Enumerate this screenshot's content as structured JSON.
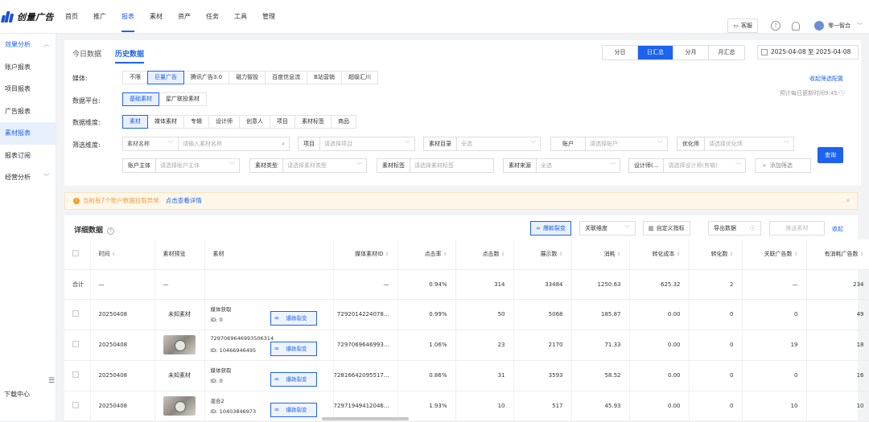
{
  "app": {
    "logo_text": "创量广告"
  },
  "topnav": {
    "items": [
      "首页",
      "推广",
      "报表",
      "素材",
      "资产",
      "任务",
      "工具",
      "管理"
    ],
    "active_index": 2
  },
  "topright": {
    "service_label": "客服",
    "help_icon": "?",
    "user_name": "零一智合"
  },
  "sidebar": {
    "groups": [
      {
        "label": "效果分析",
        "expanded": true,
        "items": [
          "账户报表",
          "项目报表",
          "广告报表",
          "素材报表",
          "报表订阅"
        ],
        "active": "素材报表"
      },
      {
        "label": "经营分析",
        "expanded": false
      }
    ],
    "bottom": "下载中心"
  },
  "tabs": [
    "今日数据",
    "历史数据"
  ],
  "active_tab": "历史数据",
  "granularity": [
    "分日",
    "日汇总",
    "分月",
    "月汇总"
  ],
  "granularity_active": "日汇总",
  "date_range": "2025-04-08 至 2025-04-08",
  "filters": {
    "media_label": "媒体:",
    "media_options": [
      "不限",
      "巨量广告",
      "腾讯广告3.0",
      "磁力智投",
      "百度信息流",
      "B站营销",
      "超级汇川"
    ],
    "media_active": "巨量广告",
    "platform_label": "数据平台:",
    "platform_options": [
      "基础素材",
      "星广联投素材"
    ],
    "platform_active": "基础素材",
    "dimension_label": "数据维度:",
    "dimension_options": [
      "素材",
      "媒体素材",
      "专辑",
      "设计师",
      "创意人",
      "项目",
      "素材标签",
      "商品"
    ],
    "dimension_active": "素材",
    "filter_label": "筛选维度:",
    "collapse_filters": "收起筛选配置",
    "update_hint": "预计每日更新时间9:45",
    "fields": {
      "name_select": "素材名称",
      "name_placeholder": "请输入素材名称",
      "project_label": "项目",
      "project_placeholder": "请选择项目",
      "dir_label": "素材目录",
      "dir_placeholder": "全选",
      "account_label": "账户",
      "account_placeholder": "请选择账户",
      "optimizer_label": "优化师",
      "optimizer_placeholder": "请选择优化师",
      "owner_label": "账户主体",
      "owner_placeholder": "请选择账户主体",
      "type_label": "素材类型",
      "type_placeholder": "请选择素材类型",
      "tag_label": "素材标签",
      "tag_placeholder": "请选择素材标签",
      "source_label": "素材来源",
      "source_placeholder": "全选",
      "designer_label": "设计师(...",
      "designer_placeholder": "请选择设计师(剪辑)",
      "add_filter": "添加筛选"
    },
    "query_button": "查询"
  },
  "alert": {
    "text": "当前有7个账户数据拉取异常",
    "link": "点击查看详情"
  },
  "table": {
    "title": "详细数据",
    "toolbar": {
      "viral": "爆款裂变",
      "related": "关联维度",
      "custom": "自定义指标",
      "export": "导出数据",
      "push": "推送素材",
      "collapse": "收起"
    },
    "headers": [
      "时间",
      "素材预览",
      "素材",
      "媒体素材ID",
      "点击率",
      "点击数",
      "展示数",
      "消耗",
      "转化成本",
      "转化数",
      "关联广告数",
      "有消耗广告数"
    ],
    "total": {
      "label": "合计",
      "time": "—",
      "preview": "—",
      "media_id": "—",
      "ctr": "0.94%",
      "clicks": "314",
      "impressions": "33484",
      "cost": "1250.63",
      "cpa": "625.32",
      "conv": "2",
      "related": "—",
      "spent_ads": "234"
    },
    "rows": [
      {
        "time": "20250408",
        "preview": "未知素材",
        "name": "媒体获取",
        "id": "ID: 0",
        "media_id": "7292014224078...",
        "ctr": "0.99%",
        "clicks": "50",
        "impressions": "5068",
        "cost": "185.87",
        "cpa": "0.00",
        "conv": "0",
        "related": "0",
        "spent_ads": "49",
        "has_thumb": false
      },
      {
        "time": "20250408",
        "preview": "",
        "name": "7297069646993506314",
        "id": "ID: 10466946495",
        "media_id": "7297069646993...",
        "ctr": "1.06%",
        "clicks": "23",
        "impressions": "2170",
        "cost": "71.33",
        "cpa": "0.00",
        "conv": "0",
        "related": "19",
        "spent_ads": "18",
        "has_thumb": true
      },
      {
        "time": "20250408",
        "preview": "未知素材",
        "name": "媒体获取",
        "id": "ID: 0",
        "media_id": "72816642095517...",
        "ctr": "0.86%",
        "clicks": "31",
        "impressions": "3593",
        "cost": "58.52",
        "cpa": "0.00",
        "conv": "0",
        "related": "0",
        "spent_ads": "16",
        "has_thumb": false
      },
      {
        "time": "20250408",
        "preview": "",
        "name": "混合2",
        "id": "ID: 10403846973",
        "media_id": "72971949412046...",
        "ctr": "1.93%",
        "clicks": "10",
        "impressions": "517",
        "cost": "45.93",
        "cpa": "0.00",
        "conv": "0",
        "related": "10",
        "spent_ads": "10",
        "has_thumb": true
      }
    ]
  },
  "colors": {
    "primary": "#1d63f0",
    "warning": "#f0a020"
  }
}
